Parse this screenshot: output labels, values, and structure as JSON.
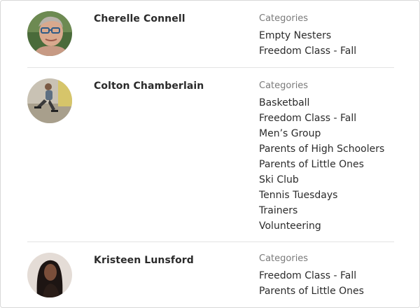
{
  "people": [
    {
      "name": "Cherelle Connell",
      "categories_heading": "Categories",
      "categories": [
        "Empty Nesters",
        "Freedom Class - Fall"
      ],
      "avatar_icon": "person-photo-icon"
    },
    {
      "name": "Colton Chamberlain",
      "categories_heading": "Categories",
      "categories": [
        "Basketball",
        "Freedom Class - Fall",
        "Men’s Group",
        "Parents of High Schoolers",
        "Parents of Little Ones",
        "Ski Club",
        "Tennis Tuesdays",
        "Trainers",
        "Volunteering"
      ],
      "avatar_icon": "person-photo-icon"
    },
    {
      "name": "Kristeen Lunsford",
      "categories_heading": "Categories",
      "categories": [
        "Freedom Class - Fall",
        "Parents of Little Ones"
      ],
      "avatar_icon": "person-photo-icon"
    }
  ],
  "colors": {
    "text": "#2b2b2b",
    "muted": "#7a7a7a",
    "divider": "#e3e3e3"
  }
}
